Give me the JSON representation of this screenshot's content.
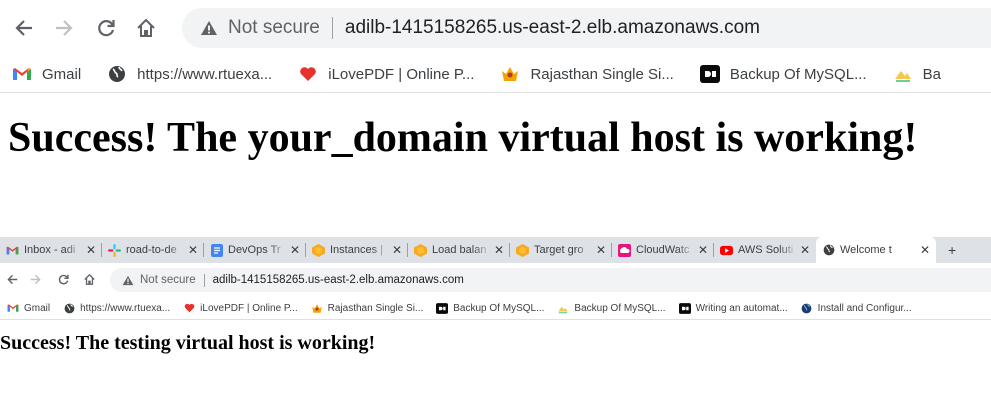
{
  "top_browser": {
    "address_bar": {
      "security_label": "Not secure",
      "url": "adilb-1415158265.us-east-2.elb.amazonaws.com"
    },
    "bookmarks": [
      {
        "label": "Gmail",
        "icon": "gmail-icon"
      },
      {
        "label": "https://www.rtuexa...",
        "icon": "globe-icon"
      },
      {
        "label": "iLovePDF | Online P...",
        "icon": "heart-icon"
      },
      {
        "label": "Rajasthan Single Si...",
        "icon": "emblem-icon"
      },
      {
        "label": "Backup Of MySQL...",
        "icon": "dev-icon"
      },
      {
        "label": "Ba",
        "icon": "folder-icon"
      }
    ],
    "heading": "Success! The your_domain virtual host is working!"
  },
  "bottom_browser": {
    "tabs": [
      {
        "label": "Inbox - adi",
        "icon": "gmail-icon"
      },
      {
        "label": "road-to-de",
        "icon": "slack-icon"
      },
      {
        "label": "DevOps Tr",
        "icon": "docs-icon"
      },
      {
        "label": "Instances |",
        "icon": "aws-icon"
      },
      {
        "label": "Load balan",
        "icon": "aws-icon"
      },
      {
        "label": "Target gro",
        "icon": "aws-icon"
      },
      {
        "label": "CloudWatc",
        "icon": "cloudwatch-icon"
      },
      {
        "label": "AWS Soluti",
        "icon": "youtube-icon"
      },
      {
        "label": "Welcome t",
        "icon": "globe-icon",
        "active": true
      }
    ],
    "new_tab_label": "+",
    "address_bar": {
      "security_label": "Not secure",
      "url": "adilb-1415158265.us-east-2.elb.amazonaws.com"
    },
    "bookmarks": [
      {
        "label": "Gmail",
        "icon": "gmail-icon"
      },
      {
        "label": "https://www.rtuexa...",
        "icon": "globe-icon"
      },
      {
        "label": "iLovePDF | Online P...",
        "icon": "heart-icon"
      },
      {
        "label": "Rajasthan Single Si...",
        "icon": "emblem-icon"
      },
      {
        "label": "Backup Of MySQL...",
        "icon": "dev-icon"
      },
      {
        "label": "Backup Of MySQL...",
        "icon": "folder-icon"
      },
      {
        "label": "Writing an automat...",
        "icon": "dev-icon"
      },
      {
        "label": "Install and Configur...",
        "icon": "globe-dark-icon"
      }
    ],
    "heading": "Success! The testing virtual host is working!"
  },
  "colors": {
    "omnibox_bg": "#f1f3f4",
    "tabstrip_bg": "#dee1e6",
    "icon_gray": "#5f6368",
    "heading_text": "#000000"
  }
}
